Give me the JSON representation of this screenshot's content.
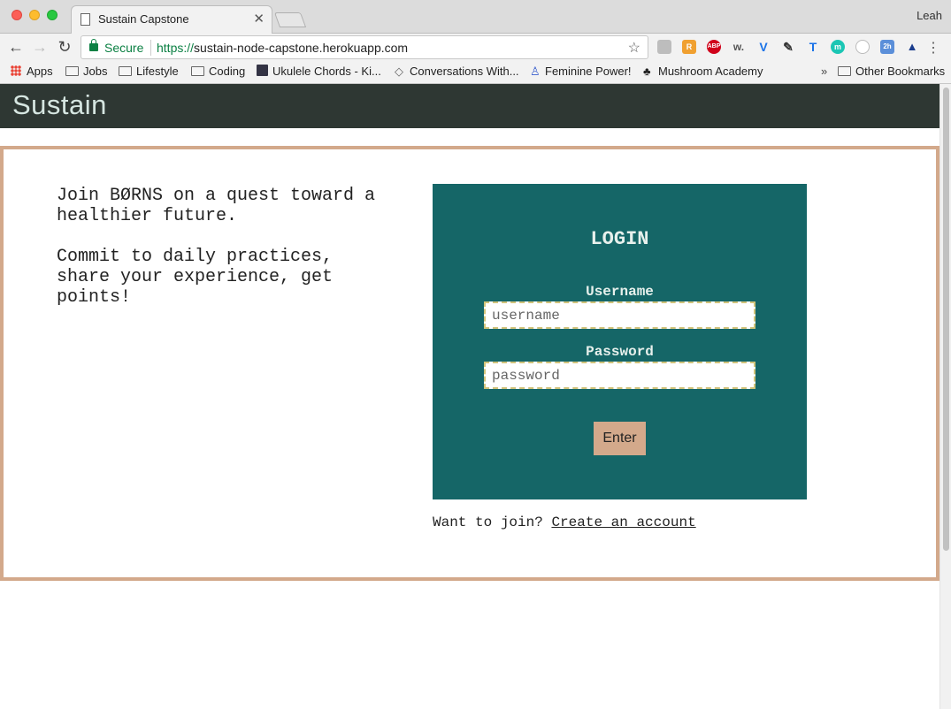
{
  "browser": {
    "tab_title": "Sustain Capstone",
    "profile_name": "Leah",
    "secure_label": "Secure",
    "url_scheme": "https://",
    "url_host": "sustain-node-capstone.herokuapp.com",
    "bookmarks": [
      "Apps",
      "Jobs",
      "Lifestyle",
      "Coding",
      "Ukulele Chords - Ki...",
      "Conversations With...",
      "Feminine Power!",
      "Mushroom Academy"
    ],
    "other_bookmarks": "Other Bookmarks",
    "overflow_chevron": "»"
  },
  "site": {
    "logo": "Sustain",
    "intro": [
      "Join BØRNS on a quest toward a healthier future.",
      "Commit to daily practices, share your experience, get points!"
    ],
    "login": {
      "title": "LOGIN",
      "username_label": "Username",
      "username_placeholder": "username",
      "password_label": "Password",
      "password_placeholder": "password",
      "submit_label": "Enter"
    },
    "join_prompt": "Want to join?",
    "join_link": "Create an account"
  },
  "colors": {
    "header_bg": "#2e3733",
    "login_bg": "#156667",
    "accent": "#d3a98b"
  }
}
